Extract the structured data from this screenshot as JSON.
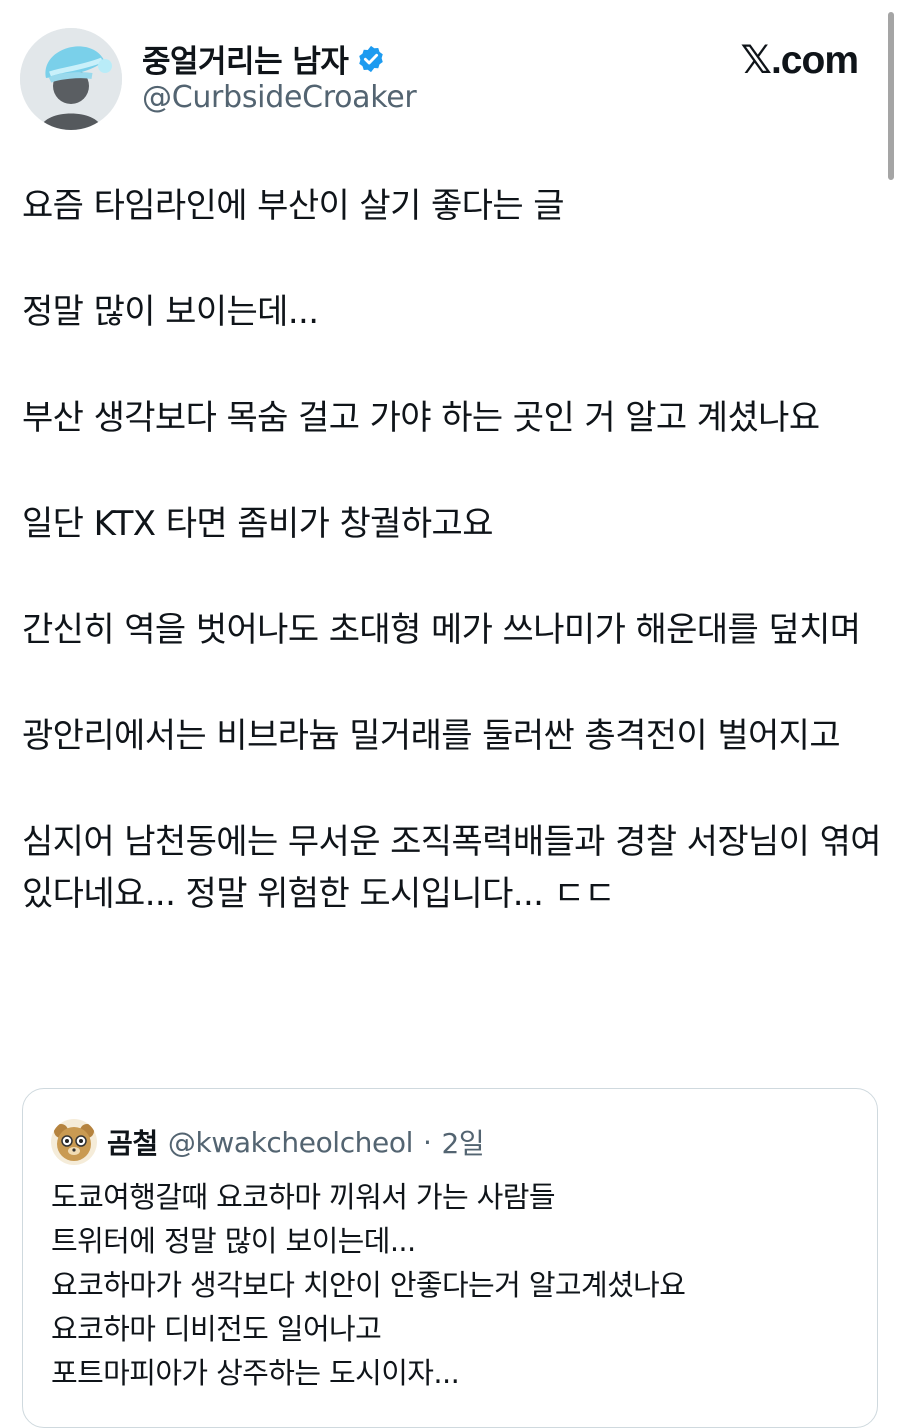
{
  "header": {
    "display_name": "중얼거리는 남자",
    "handle": "@CurbsideCroaker",
    "site": "𝕏.com",
    "verified": true,
    "verified_color": "#1d9bf0"
  },
  "tweet": {
    "paragraphs": [
      "요즘 타임라인에 부산이 살기 좋다는 글",
      "정말 많이 보이는데...",
      "부산 생각보다 목숨 걸고 가야 하는 곳인 거 알고 계셨나요",
      "일단 KTX 타면 좀비가 창궐하고요",
      "간신히 역을 벗어나도 초대형 메가 쓰나미가 해운대를 덮치며",
      "광안리에서는 비브라늄 밀거래를 둘러싼 총격전이 벌어지고",
      "심지어 남천동에는 무서운 조직폭력배들과 경찰 서장님이 엮여있다네요... 정말 위험한 도시입니다... ㄷㄷ"
    ]
  },
  "quote": {
    "name": "곰철",
    "handle": "@kwakcheolcheol",
    "dot": "·",
    "time": "2일",
    "lines": [
      "도쿄여행갈때 요코하마 끼워서 가는 사람들",
      "트위터에 정말 많이 보이는데...",
      "요코하마가 생각보다 치안이 안좋다는거 알고계셨나요",
      "요코하마 디비전도 일어나고",
      "포트마피아가 상주하는 도시이자..."
    ]
  }
}
